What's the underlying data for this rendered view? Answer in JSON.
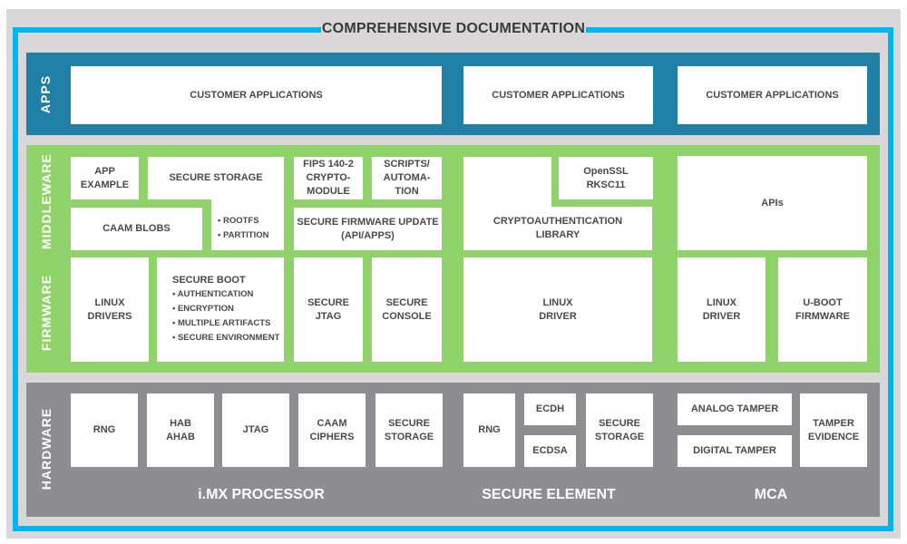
{
  "title": "COMPREHENSIVE DOCUMENTATION",
  "colors": {
    "frame": "#00b4f0",
    "background": "#d9d7d8",
    "apps": "#1f7fa5",
    "middleware_firmware": "#8fd36a",
    "hardware": "#8e8d91",
    "box": "#ffffff",
    "box_text": "#4a4a4a"
  },
  "layers": {
    "apps": "APPS",
    "middleware": "MIDDLEWARE",
    "firmware": "FIRMWARE",
    "hardware": "HARDWARE"
  },
  "apps": {
    "imx": "CUSTOMER APPLICATIONS",
    "secure_element": "CUSTOMER APPLICATIONS",
    "mca": "CUSTOMER APPLICATIONS"
  },
  "middleware": {
    "app_example": [
      "APP",
      "EXAMPLE"
    ],
    "secure_storage": "SECURE STORAGE",
    "secure_storage_bullets": [
      "• ROOTFS",
      "• PARTITION"
    ],
    "caam_blobs": "CAAM BLOBS",
    "fips": [
      "FIPS 140-2",
      "CRYPTO-",
      "MODULE"
    ],
    "scripts": [
      "SCRIPTS/",
      "AUTOMA-",
      "TION"
    ],
    "secure_fw_update": [
      "SECURE FIRMWARE UPDATE",
      "(API/APPS)"
    ],
    "openssl": [
      "OpenSSL",
      "RKSC11"
    ],
    "cryptoauth": [
      "CRYPTOAUTHENTICATION",
      "LIBRARY"
    ],
    "apis": "APIs"
  },
  "firmware": {
    "linux_drivers": [
      "LINUX",
      "DRIVERS"
    ],
    "secure_boot": "SECURE BOOT",
    "secure_boot_bullets": [
      "• AUTHENTICATION",
      "• ENCRYPTION",
      "• MULTIPLE ARTIFACTS",
      "• SECURE ENVIRONMENT"
    ],
    "secure_jtag": [
      "SECURE",
      "JTAG"
    ],
    "secure_console": [
      "SECURE",
      "CONSOLE"
    ],
    "se_linux_driver": [
      "LINUX",
      "DRIVER"
    ],
    "mca_linux_driver": [
      "LINUX",
      "DRIVER"
    ],
    "uboot": [
      "U-BOOT",
      "FIRMWARE"
    ]
  },
  "hardware": {
    "imx_label": "i.MX PROCESSOR",
    "se_label": "SECURE ELEMENT",
    "mca_label": "MCA",
    "imx": {
      "rng": "RNG",
      "hab": [
        "HAB",
        "AHAB"
      ],
      "jtag": "JTAG",
      "caam": [
        "CAAM",
        "CIPHERS"
      ],
      "storage": [
        "SECURE",
        "STORAGE"
      ]
    },
    "se": {
      "rng": "RNG",
      "ecdh": "ECDH",
      "ecdsa": "ECDSA",
      "storage": [
        "SECURE",
        "STORAGE"
      ]
    },
    "mca": {
      "analog": "ANALOG TAMPER",
      "digital": "DIGITAL TAMPER",
      "evidence": [
        "TAMPER",
        "EVIDENCE"
      ]
    }
  }
}
